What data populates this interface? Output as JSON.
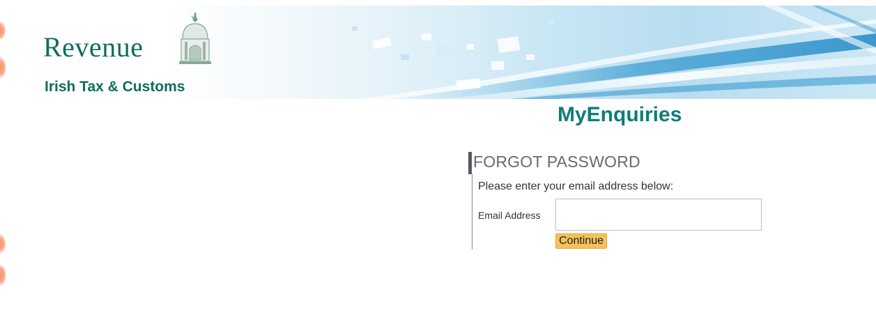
{
  "header": {
    "brand_name": "Revenue",
    "brand_subtitle": "Irish Tax & Customs",
    "logo_icon": "custom-house-icon"
  },
  "app": {
    "title": "MyEnquiries"
  },
  "form": {
    "heading": "FORGOT PASSWORD",
    "instruction": "Please enter your email address below:",
    "email_label": "Email Address",
    "email_value": "",
    "continue_label": "Continue"
  },
  "colors": {
    "brand_green": "#0e6d5c",
    "title_teal": "#0e7d78",
    "button_yellow": "#f5c15a",
    "heading_grey": "#666a6e"
  }
}
